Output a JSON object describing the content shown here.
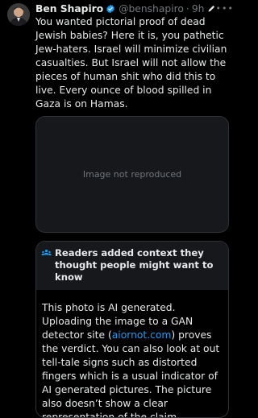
{
  "author": {
    "display_name": "Ben Shapiro",
    "handle": "@benshapiro",
    "separator": "·",
    "time": "9h",
    "more": "•••",
    "verified_color": "#1d9bf0"
  },
  "post": {
    "text": "You wanted pictorial proof of dead Jewish babies? Here it is, you pathetic Jew-haters. Israel will minimize civilian casualties. But Israel will not allow the pieces of human shit who did this to live. Every ounce of blood spilled in Gaza is on Hamas."
  },
  "media": {
    "placeholder_label": "Image not reproduced"
  },
  "community_note": {
    "header": "Readers added context they thought people might want to know",
    "text_before_link": "This photo is AI generated. Uploading the image to a GAN detector site (",
    "link_text": "aiornot.com",
    "text_after_link": ") proves the verdict. You can also look at out tell-tale signs such as distorted fingers which is a usual indicator of AI generated pictures. The picture also doesn’t show a clear representation of the claim",
    "link_color": "#1d9bf0"
  },
  "theme": {
    "background": "#000000",
    "text": "#e7e9ea",
    "muted": "#71767b",
    "border": "#2f3336"
  }
}
